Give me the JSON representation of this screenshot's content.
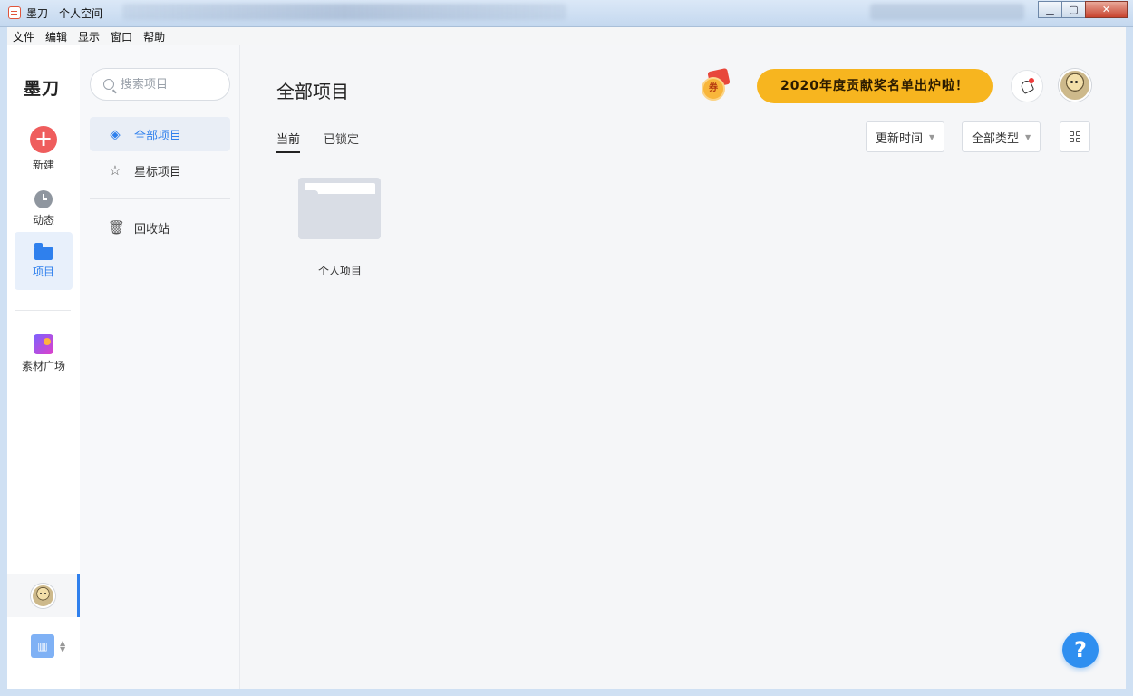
{
  "window": {
    "title": "墨刀 - 个人空间"
  },
  "menu": [
    "文件",
    "编辑",
    "显示",
    "窗口",
    "帮助"
  ],
  "nav": {
    "logo": "墨刀",
    "items": [
      {
        "label": "新建"
      },
      {
        "label": "动态"
      },
      {
        "label": "项目"
      },
      {
        "label": "素材广场"
      }
    ],
    "team_icon": "🏢"
  },
  "sidebar": {
    "search_placeholder": "搜索项目",
    "items": [
      {
        "label": "全部项目"
      },
      {
        "label": "星标项目"
      },
      {
        "label": "回收站"
      }
    ]
  },
  "main": {
    "title": "全部项目",
    "tabs": [
      "当前",
      "已锁定"
    ],
    "promo": "2020年度贡献奖名单出炉啦！",
    "coupon_label": "券",
    "sort_label": "更新时间",
    "type_label": "全部类型",
    "folders": [
      {
        "name": "个人项目"
      }
    ],
    "help": "?"
  },
  "colors": {
    "accent": "#2f80ed",
    "promo": "#f7b51f",
    "new": "#ef5d5d"
  }
}
